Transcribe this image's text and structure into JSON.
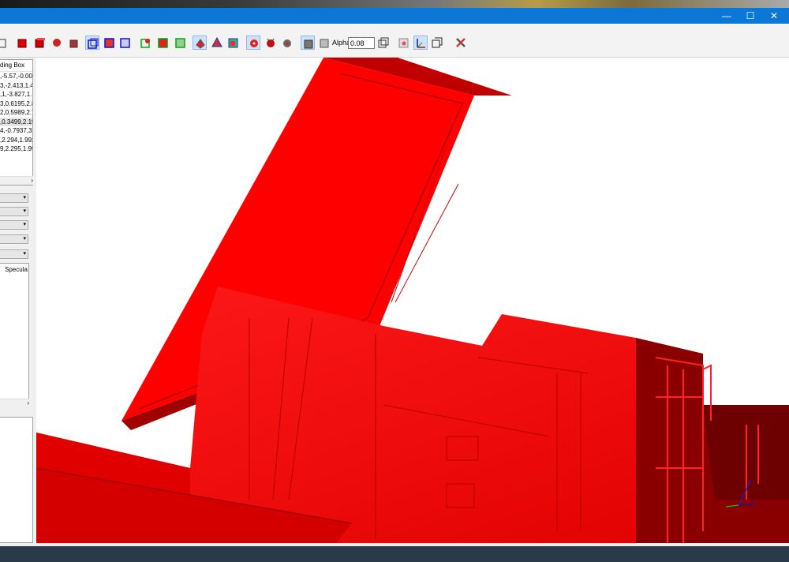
{
  "window": {
    "controls": {
      "minimize": "—",
      "maximize": "☐",
      "close": "✕"
    }
  },
  "toolbar": {
    "alpha_label": "Alpha:",
    "alpha_value": "0.08",
    "buttons": [
      "box-icon",
      "solid-red-cube-icon",
      "solid-red-cube-2-icon",
      "shaded-red-cube-icon",
      "dark-cube-icon",
      "wire-blue-cube-active-icon",
      "wire-blue-cube-icon",
      "wire-blue-cube-2-icon",
      "wire-green-cube-icon",
      "wire-green-cube-2-icon",
      "wire-green-cube-3-icon",
      "red-blob-icon",
      "red-mesh-icon",
      "red-mesh-2-icon",
      "red-dot-icon",
      "red-bug-icon",
      "gear-blob-icon",
      "gray-cube-active-icon",
      "gray-cube-icon",
      "outline-cube-icon",
      "cube-eye-icon",
      "axes-icon",
      "open-box-icon",
      "tools-icon"
    ]
  },
  "left_panel": {
    "list_header": "ding Box",
    "rows": [
      ",-5.57,-0.002",
      "3,-2.413,1.4",
      ",1,-3.827,1.7",
      "3,0.6195,2.8",
      "2,0.5989,2.7",
      ",0.3499,2.19",
      "4,-0.7937,3.",
      ",2.294,1.992",
      "9,2.295,1.99"
    ],
    "selected_row": 5,
    "panel2_text": "Specula"
  },
  "colors": {
    "titlebar": "#0b78d7",
    "model_red": "#ff0000",
    "model_dark": "#8a0000"
  }
}
